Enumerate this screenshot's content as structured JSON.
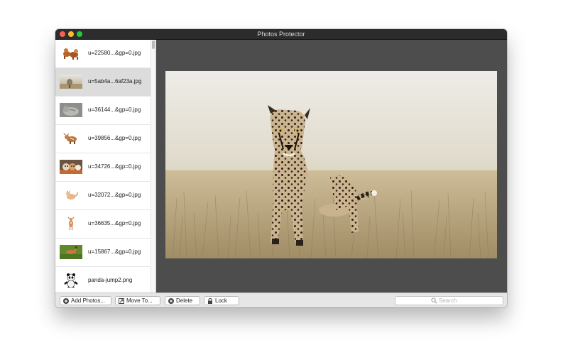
{
  "window": {
    "title": "Photos Protector"
  },
  "sidebar": {
    "items": [
      {
        "label": "u=22580...&gp=0.jpg",
        "thumb_icon": "dogs-thumbnail"
      },
      {
        "label": "u=5ab4a...6af23a.jpg",
        "thumb_icon": "cheetah-thumbnail",
        "selected": true
      },
      {
        "label": "u=36144...&gp=0.jpg",
        "thumb_icon": "cat-thumbnail"
      },
      {
        "label": "u=39856...&gp=0.jpg",
        "thumb_icon": "fawn-thumbnail"
      },
      {
        "label": "u=34726...&gp=0.jpg",
        "thumb_icon": "kittens-thumbnail"
      },
      {
        "label": "u=32072...&gp=0.jpg",
        "thumb_icon": "kitten-thumbnail"
      },
      {
        "label": "u=36635...&gp=0.jpg",
        "thumb_icon": "deer-thumbnail"
      },
      {
        "label": "u=15867...&gp=0.jpg",
        "thumb_icon": "antelope-thumbnail"
      },
      {
        "label": "panda-jump2.png",
        "thumb_icon": "panda-thumbnail"
      }
    ]
  },
  "preview": {
    "image": "cheetah-photo"
  },
  "toolbar": {
    "add_label": "Add Photos...",
    "move_label": "Move To...",
    "delete_label": "Delete",
    "lock_label": "Lock",
    "search_placeholder": "Search"
  },
  "colors": {
    "titlebar": "#2c2c2c",
    "preview_background": "#4d4d4d",
    "selection": "#dcdcdc",
    "close": "#fc5f57",
    "minimize": "#fdbc2e",
    "maximize": "#28c840"
  }
}
